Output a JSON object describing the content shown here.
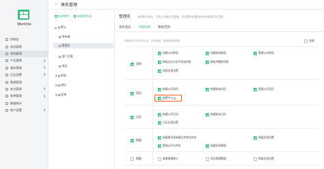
{
  "app": {
    "brand": "Worktile"
  },
  "sidebar": {
    "items": [
      {
        "label": "控制台",
        "icon": "dashboard-icon"
      },
      {
        "label": "成员管理",
        "icon": "members-icon"
      },
      {
        "label": "角色管理",
        "icon": "roles-icon"
      },
      {
        "label": "产品管理",
        "icon": "product-icon"
      },
      {
        "label": "服务管理",
        "icon": "service-icon"
      },
      {
        "label": "企业设置",
        "icon": "enterprise-icon"
      },
      {
        "label": "数据管理",
        "icon": "data-icon"
      },
      {
        "label": "安全管理",
        "icon": "security-icon"
      },
      {
        "label": "账单管理",
        "icon": "billing-icon"
      },
      {
        "label": "数据统计",
        "icon": "statistics-icon"
      },
      {
        "label": "帐户设置",
        "icon": "account-icon"
      }
    ]
  },
  "header": {
    "back_icon": "‹",
    "title": "角色管理"
  },
  "tree": {
    "new_role": "新建角色",
    "new_role_group": "新建角色组",
    "nodes": [
      {
        "label": "默认"
      },
      {
        "label": "所有者"
      },
      {
        "label": "管理员"
      },
      {
        "label": "部门主管"
      },
      {
        "label": "成员"
      },
      {
        "label": "职务"
      },
      {
        "label": "岗位"
      },
      {
        "label": "区域"
      }
    ]
  },
  "main": {
    "role_title": "管理员",
    "role_desc": "系统默认角色，可在企业级后台管理，并设置所在模块的所有权限可见范围",
    "tabs": [
      "角色成员",
      "功能权限",
      "数据范围"
    ],
    "hint": "设置角色可访问的应用，应用管理、数据的管理权限",
    "select_all": "全选"
  },
  "permissions": [
    {
      "module": "消息",
      "items": [
        "创建公开群组",
        "创建私有群组",
        "管理公开群组",
        "群组企业公告中发送消息",
        "群组中删除消息",
        "消息应用设置"
      ]
    },
    {
      "module": "项目",
      "items": [
        "新建公开项目",
        "新建私有项目",
        "管理公开项目",
        "配置中心"
      ]
    },
    {
      "module": "日历",
      "items": [
        "新建公开日历",
        "新建私有日历",
        "日历应用设置"
      ]
    },
    {
      "module": "网盘",
      "items": [
        "网盘根目录新建文件和文件夹",
        "网盘标签管理",
        "网盘应用设置",
        "管理公开文件夹"
      ]
    },
    {
      "module": "简报",
      "items": [
        "查看简报统计",
        "导出简报数据",
        "简报应用设置"
      ]
    }
  ]
}
